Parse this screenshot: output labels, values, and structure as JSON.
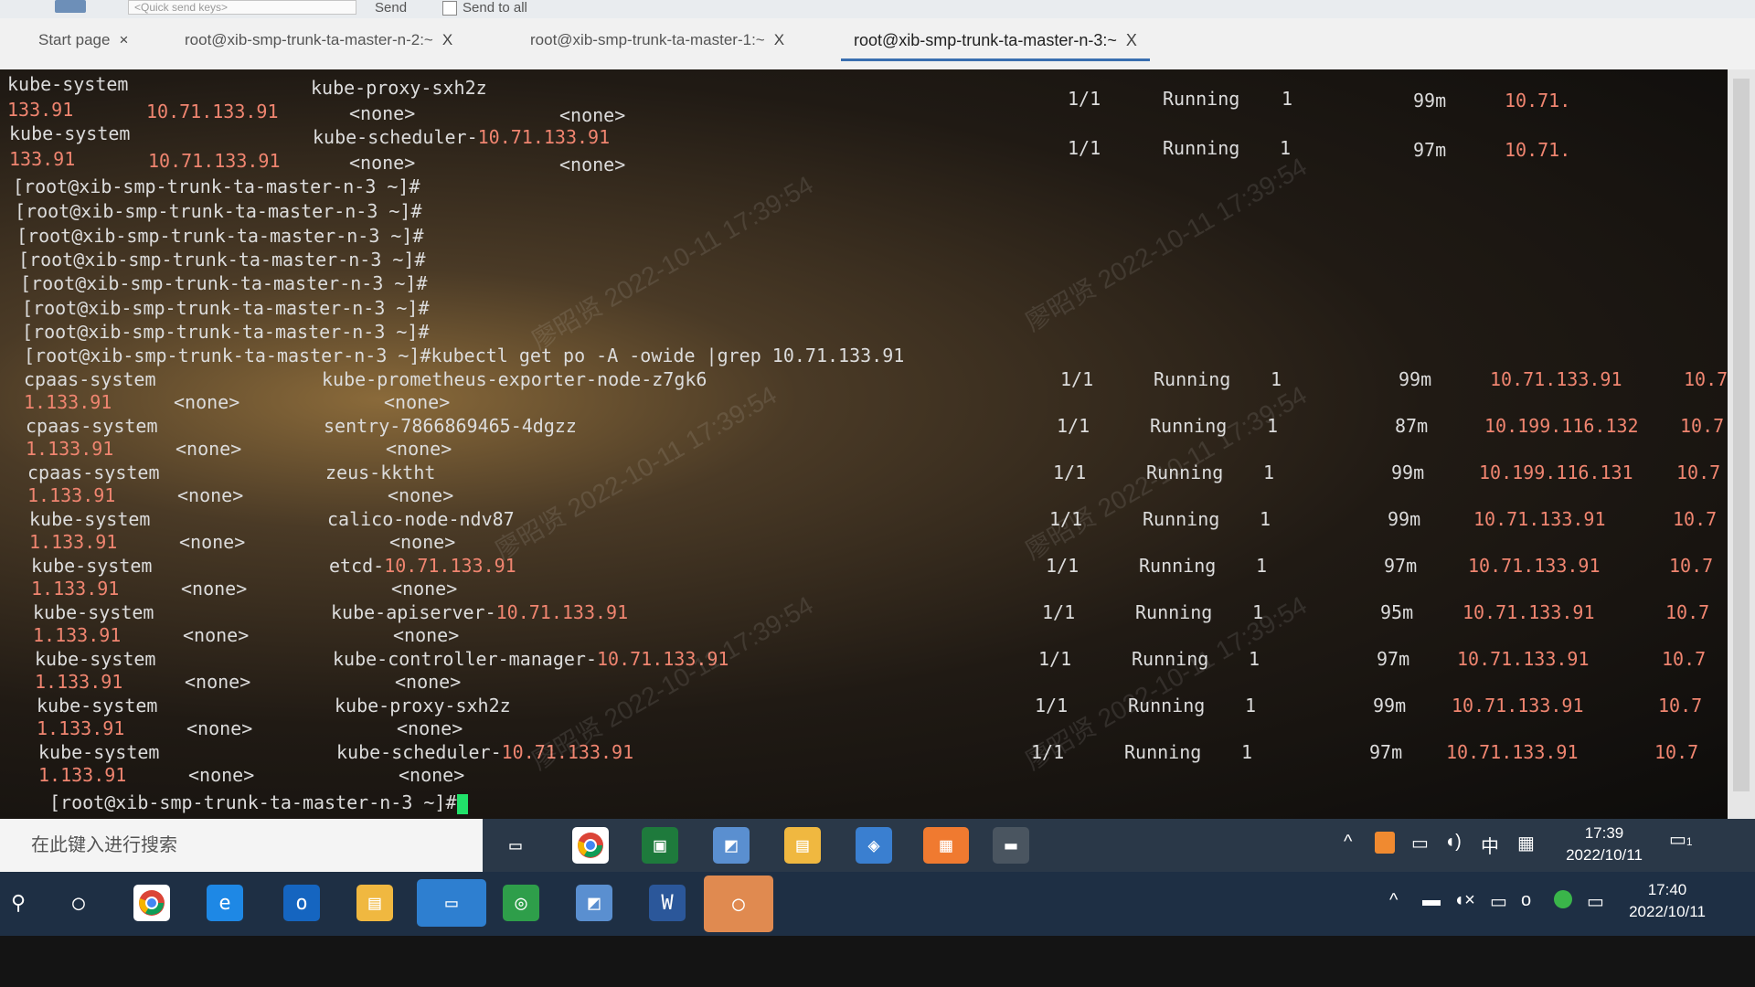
{
  "toolbar": {
    "quick_send_placeholder": "<Quick send keys>",
    "send_label": "Send",
    "send_to_all_label": "Send to all"
  },
  "tabs": [
    {
      "label": "Start page",
      "close": "×"
    },
    {
      "label": "root@xib-smp-trunk-ta-master-n-2:~",
      "close": "X"
    },
    {
      "label": "root@xib-smp-trunk-ta-master-1:~",
      "close": "X"
    },
    {
      "label": "root@xib-smp-trunk-ta-master-n-3:~",
      "close": "X"
    }
  ],
  "terminal": {
    "prompt": "[root@xib-smp-trunk-ta-master-n-3 ~]#",
    "command": "kubectl get po -A -owide |grep 10.71.133.91",
    "previous_rows": [
      {
        "namespace": "kube-system",
        "name": "kube-proxy-sxh2z",
        "ready": "1/1",
        "status": "Running",
        "restarts": "1",
        "age": "99m",
        "ip": "10.71.",
        "wrap_ip": "133.91",
        "node": "10.71.133.91",
        "nominated": "<none>",
        "gates": "<none>"
      },
      {
        "namespace": "kube-system",
        "name": "kube-scheduler-",
        "name_ip": "10.71.133.91",
        "ready": "1/1",
        "status": "Running",
        "restarts": "1",
        "age": "97m",
        "ip": "10.71.",
        "wrap_ip": "133.91",
        "node": "10.71.133.91",
        "nominated": "<none>",
        "gates": "<none>"
      }
    ],
    "rows": [
      {
        "namespace": "cpaas-system",
        "name": "kube-prometheus-exporter-node-z7gk6",
        "name_ip": "",
        "ready": "1/1",
        "status": "Running",
        "restarts": "1",
        "age": "99m",
        "ip": "10.71.133.91",
        "node_short": "10.7",
        "wrap_ip": "1.133.91",
        "nominated": "<none>",
        "gates": "<none>"
      },
      {
        "namespace": "cpaas-system",
        "name": "sentry-7866869465-4dgzz",
        "name_ip": "",
        "ready": "1/1",
        "status": "Running",
        "restarts": "1",
        "age": "87m",
        "ip": "10.199.116.132",
        "node_short": "10.7",
        "wrap_ip": "1.133.91",
        "nominated": "<none>",
        "gates": "<none>"
      },
      {
        "namespace": "cpaas-system",
        "name": "zeus-kktht",
        "name_ip": "",
        "ready": "1/1",
        "status": "Running",
        "restarts": "1",
        "age": "99m",
        "ip": "10.199.116.131",
        "node_short": "10.7",
        "wrap_ip": "1.133.91",
        "nominated": "<none>",
        "gates": "<none>"
      },
      {
        "namespace": "kube-system",
        "name": "calico-node-ndv87",
        "name_ip": "",
        "ready": "1/1",
        "status": "Running",
        "restarts": "1",
        "age": "99m",
        "ip": "10.71.133.91",
        "node_short": "10.7",
        "wrap_ip": "1.133.91",
        "nominated": "<none>",
        "gates": "<none>"
      },
      {
        "namespace": "kube-system",
        "name": "etcd-",
        "name_ip": "10.71.133.91",
        "ready": "1/1",
        "status": "Running",
        "restarts": "1",
        "age": "97m",
        "ip": "10.71.133.91",
        "node_short": "10.7",
        "wrap_ip": "1.133.91",
        "nominated": "<none>",
        "gates": "<none>"
      },
      {
        "namespace": "kube-system",
        "name": "kube-apiserver-",
        "name_ip": "10.71.133.91",
        "ready": "1/1",
        "status": "Running",
        "restarts": "1",
        "age": "95m",
        "ip": "10.71.133.91",
        "node_short": "10.7",
        "wrap_ip": "1.133.91",
        "nominated": "<none>",
        "gates": "<none>"
      },
      {
        "namespace": "kube-system",
        "name": "kube-controller-manager-",
        "name_ip": "10.71.133.91",
        "ready": "1/1",
        "status": "Running",
        "restarts": "1",
        "age": "97m",
        "ip": "10.71.133.91",
        "node_short": "10.7",
        "wrap_ip": "1.133.91",
        "nominated": "<none>",
        "gates": "<none>"
      },
      {
        "namespace": "kube-system",
        "name": "kube-proxy-sxh2z",
        "name_ip": "",
        "ready": "1/1",
        "status": "Running",
        "restarts": "1",
        "age": "99m",
        "ip": "10.71.133.91",
        "node_short": "10.7",
        "wrap_ip": "1.133.91",
        "nominated": "<none>",
        "gates": "<none>"
      },
      {
        "namespace": "kube-system",
        "name": "kube-scheduler-",
        "name_ip": "10.71.133.91",
        "ready": "1/1",
        "status": "Running",
        "restarts": "1",
        "age": "97m",
        "ip": "10.71.133.91",
        "node_short": "10.7",
        "wrap_ip": "1.133.91",
        "nominated": "<none>",
        "gates": "<none>"
      }
    ]
  },
  "taskbar_inner": {
    "search_placeholder": "在此键入进行搜索",
    "ime_label": "中",
    "time": "17:39",
    "date": "2022/10/11",
    "notification_count": "1"
  },
  "taskbar_outer": {
    "time": "17:40",
    "date": "2022/10/11"
  },
  "watermark": {
    "name": "廖昭贤",
    "timestamp": "2022-10-11 17:39:54"
  },
  "colors": {
    "terminal_text": "#dcdcdc",
    "ip_highlight": "#f08570",
    "cursor": "#21e26a",
    "active_tab_accent": "#3a6fb0"
  }
}
